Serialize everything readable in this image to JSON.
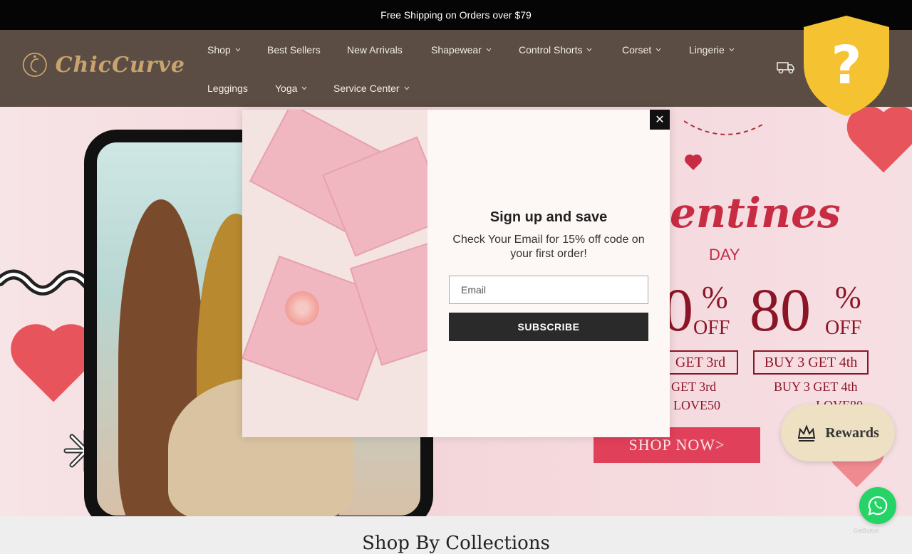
{
  "announcement": "Free Shipping on Orders over $79",
  "brand": {
    "name": "ChicCurve",
    "accent": "#c8a36d"
  },
  "nav": {
    "items": [
      {
        "label": "Shop",
        "has_dropdown": true
      },
      {
        "label": "Best Sellers",
        "has_dropdown": false
      },
      {
        "label": "New Arrivals",
        "has_dropdown": false
      },
      {
        "label": "Shapewear",
        "has_dropdown": true
      },
      {
        "label": "Control Shorts",
        "has_dropdown": true
      },
      {
        "label": "Corset",
        "has_dropdown": true
      },
      {
        "label": "Lingerie",
        "has_dropdown": true
      },
      {
        "label": "Leggings",
        "has_dropdown": false
      },
      {
        "label": "Yoga",
        "has_dropdown": true
      },
      {
        "label": "Service Center",
        "has_dropdown": true
      }
    ]
  },
  "header_icons": {
    "shipping": "truck-icon",
    "help": "question-shield-icon"
  },
  "hero": {
    "title_partial": "entines",
    "day": "DAY",
    "offers": [
      {
        "percent": "0",
        "off": "OFF",
        "buy": "GET 3rd",
        "detail": "GET 3rd",
        "code": "LOVE50"
      },
      {
        "percent": "80",
        "off": "OFF",
        "buy": "BUY 3 GET 4th",
        "detail": "BUY 3 GET 4th",
        "code": "LOVE80"
      }
    ],
    "percent_sign": "%",
    "cta": "SHOP NOW>"
  },
  "popup": {
    "title": "Sign up and save",
    "text": "Check Your Email for 15% off code on your first order!",
    "email_placeholder": "Email",
    "button": "SUBSCRIBE",
    "close": "✕"
  },
  "rewards": {
    "label": "Rewards"
  },
  "section": {
    "title": "Shop By Collections"
  },
  "whatsapp": {
    "small_label": "GetButton"
  }
}
